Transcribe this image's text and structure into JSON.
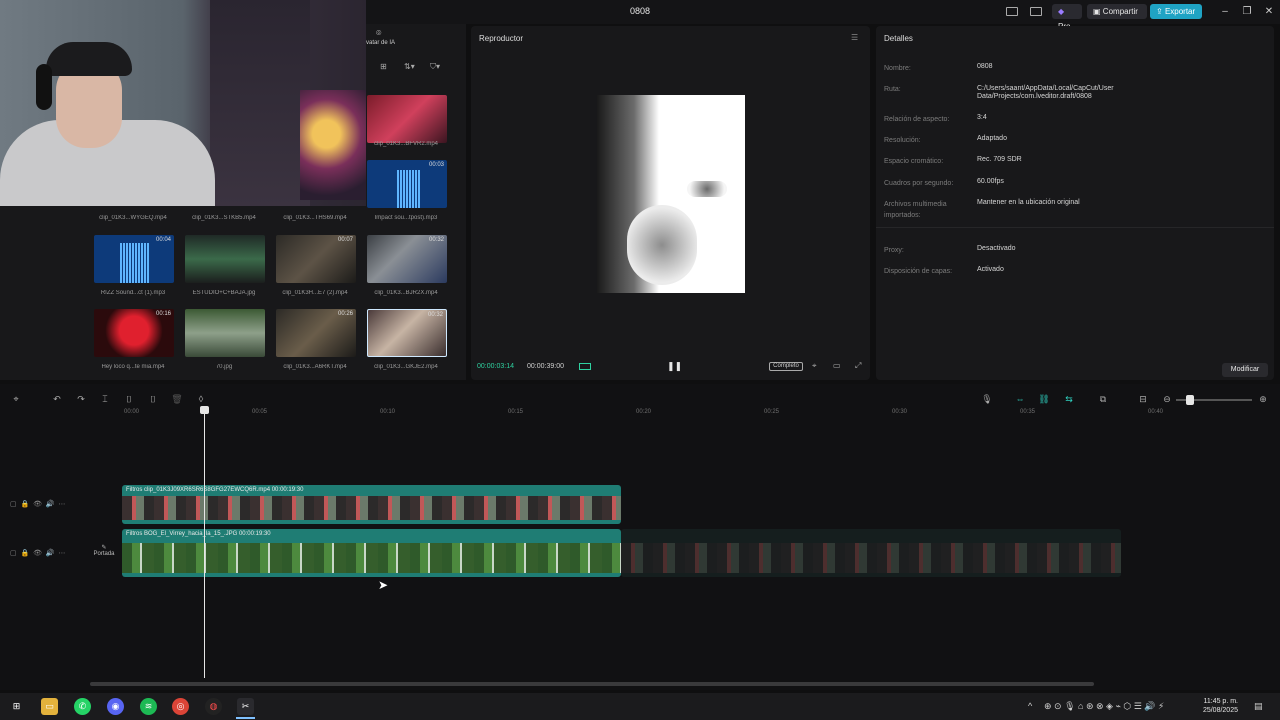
{
  "titlebar": {
    "project_title": "0808",
    "pro_label": "Pro",
    "share_label": "Compartir",
    "export_label": "Exportar"
  },
  "media": {
    "tool_label": "vatar de IA",
    "items": [
      {
        "name": "clip_01K3...BFVR2.mp4",
        "duration": ""
      },
      {
        "name": "Impact sou...tpost).mp3",
        "duration": "00:03"
      },
      {
        "name": "clip_01K3...WYGEQ.mp4",
        "duration": ""
      },
      {
        "name": "clip_01K3...STKB5.mp4",
        "duration": ""
      },
      {
        "name": "clip_01K3...THS69.mp4",
        "duration": ""
      },
      {
        "name": "RIZZ Sound...ct (1).mp3",
        "duration": "00:04"
      },
      {
        "name": "ESTUDIO+C+BAJA.jpg",
        "duration": ""
      },
      {
        "name": "clip_01K3H...E7 (2).mp4",
        "duration": "00:07"
      },
      {
        "name": "clip_01K3...BJR2X.mp4",
        "duration": "00:32"
      },
      {
        "name": "Hey loco q...te mia.mp4",
        "duration": "00:16"
      },
      {
        "name": "70.jpg",
        "duration": ""
      },
      {
        "name": "clip_01K3...A6RKT.mp4",
        "duration": "00:26"
      },
      {
        "name": "clip_01K3...GKJE2.mp4",
        "duration": "00:32"
      }
    ]
  },
  "player": {
    "title": "Reproductor",
    "current_time": "00:00:03:14",
    "total_time": "00:00:39:00",
    "ratio_label": "Completo"
  },
  "details": {
    "title": "Detalles",
    "rows": [
      {
        "label": "Nombre:",
        "value": "0808"
      },
      {
        "label": "Ruta:",
        "value": "C:/Users/saant/AppData/Local/CapCut/User Data/Projects/com.lveditor.draft/0808"
      },
      {
        "label": "Relación de aspecto:",
        "value": "3:4"
      },
      {
        "label": "Resolución:",
        "value": "Adaptado"
      },
      {
        "label": "Espacio cromático:",
        "value": "Rec. 709 SDR"
      },
      {
        "label": "Cuadros por segundo:",
        "value": "60.00fps"
      },
      {
        "label": "Archivos multimedia importados:",
        "value": "Mantener en la ubicación original"
      },
      {
        "label": "Proxy:",
        "value": "Desactivado"
      },
      {
        "label": "Disposición de capas:",
        "value": "Activado"
      }
    ],
    "modify_label": "Modificar"
  },
  "timeline": {
    "ruler": [
      "00:00",
      "00:05",
      "00:10",
      "00:15",
      "00:20",
      "00:25",
      "00:30",
      "00:35",
      "00:40"
    ],
    "cover_label": "Portada",
    "clips": [
      {
        "label": "Filtros  clip_01K3J09XR6SR6S8GFG27EWCQ6R.mp4  00:00:19:30"
      },
      {
        "label": "Filtros  BOG_El_Virrey_hacia_la_15_.JPG  00:00:19:30"
      }
    ]
  },
  "taskbar": {
    "time": "11:45 p. m.",
    "date": "25/08/2025"
  }
}
